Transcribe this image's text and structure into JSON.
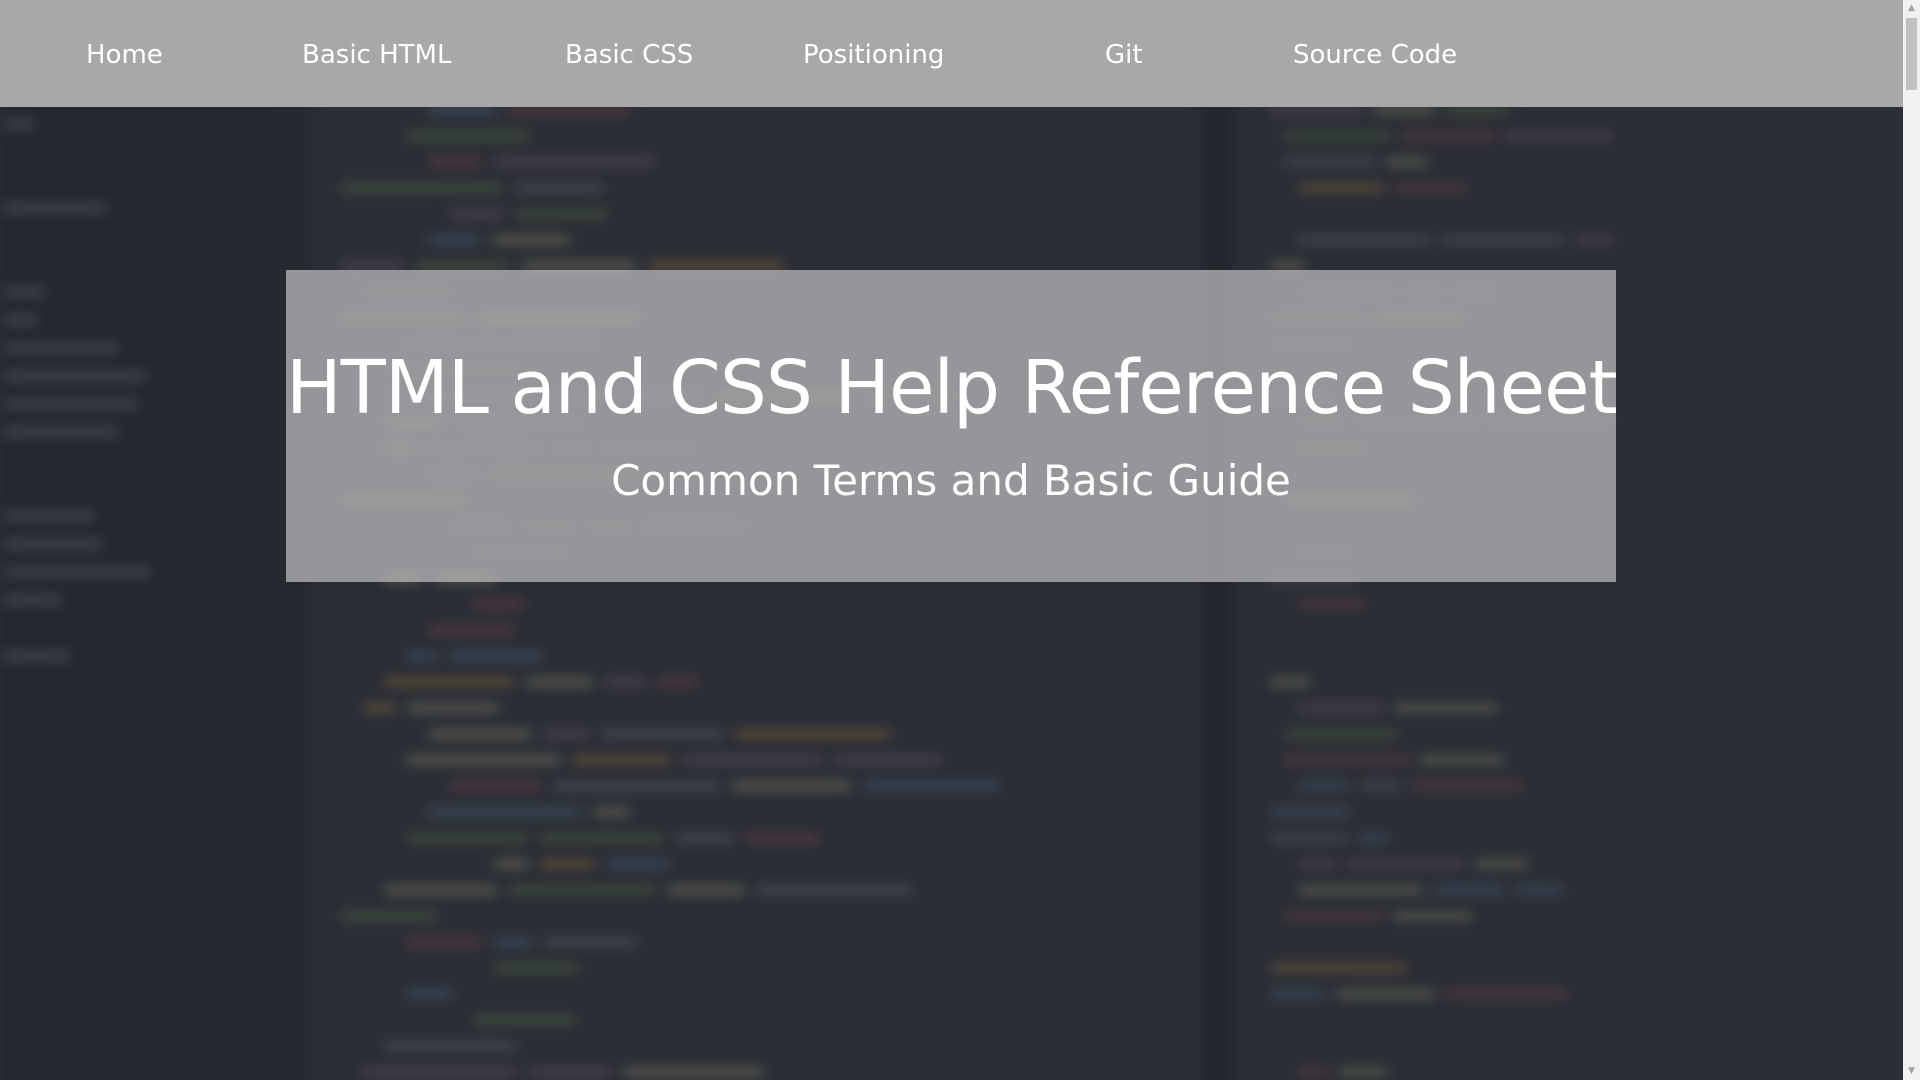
{
  "nav": {
    "items": [
      {
        "label": "Home"
      },
      {
        "label": "Basic HTML"
      },
      {
        "label": "Basic CSS"
      },
      {
        "label": "Positioning"
      },
      {
        "label": "Git"
      },
      {
        "label": "Source Code"
      }
    ]
  },
  "hero": {
    "title": "HTML and CSS Help Reference Sheet",
    "subtitle": "Common Terms and Basic Guide"
  },
  "background": {
    "description_icon": "blurred-code-editor",
    "base_color": "#2b2e36"
  },
  "colors": {
    "nav_background": "#a8a8a8",
    "hero_overlay": "#b4b4b6",
    "text": "#ffffff"
  },
  "scrollbar": {
    "up_icon": "scroll-up-arrow-icon",
    "down_icon": "scroll-down-arrow-icon"
  }
}
